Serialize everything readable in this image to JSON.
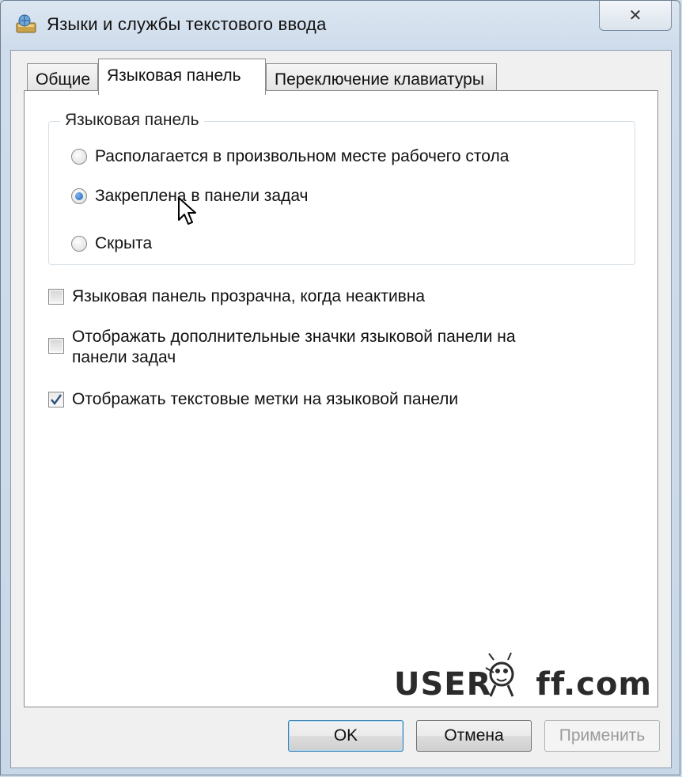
{
  "window": {
    "title": "Языки и службы текстового ввода",
    "close_glyph": "✕"
  },
  "tabs": [
    {
      "label": "Общие",
      "active": false
    },
    {
      "label": "Языковая панель",
      "active": true
    },
    {
      "label": "Переключение клавиатуры",
      "active": false
    }
  ],
  "language_bar_group": {
    "legend": "Языковая панель",
    "options": [
      {
        "label": "Располагается в произвольном месте рабочего стола",
        "selected": false
      },
      {
        "label": "Закреплена в панели задач",
        "selected": true
      },
      {
        "label": "Скрыта",
        "selected": false
      }
    ]
  },
  "checkboxes": [
    {
      "label": "Языковая панель прозрачна, когда неактивна",
      "checked": false
    },
    {
      "label_line1": "Отображать дополнительные значки языковой панели на",
      "label_line2": "панели задач",
      "checked": false
    },
    {
      "label": "Отображать текстовые метки на языковой панели",
      "checked": true
    }
  ],
  "buttons": {
    "ok": "OK",
    "cancel": "Отмена",
    "apply": "Применить"
  },
  "watermark": {
    "left": "USER",
    "right": "ff.com"
  },
  "colors": {
    "radio_selected": "#1c5bb5",
    "check_mark": "#2b4f80",
    "window_frame": "#cfdde9"
  }
}
